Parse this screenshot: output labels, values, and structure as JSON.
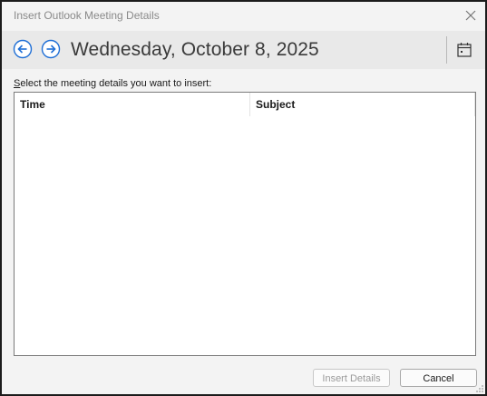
{
  "window": {
    "title": "Insert Outlook Meeting Details",
    "icons": {
      "close": "close-icon"
    }
  },
  "nav": {
    "date": "Wednesday, October 8, 2025",
    "icons": {
      "prev": "arrow-left-icon",
      "next": "arrow-right-icon",
      "calendar": "calendar-icon"
    },
    "accent": "#1f6fd6"
  },
  "prompt": {
    "underlined": "S",
    "rest": "elect the meeting details you want to insert:"
  },
  "table": {
    "columns": [
      "Time",
      "Subject"
    ],
    "rows": []
  },
  "buttons": {
    "insert": "Insert Details",
    "cancel": "Cancel"
  }
}
